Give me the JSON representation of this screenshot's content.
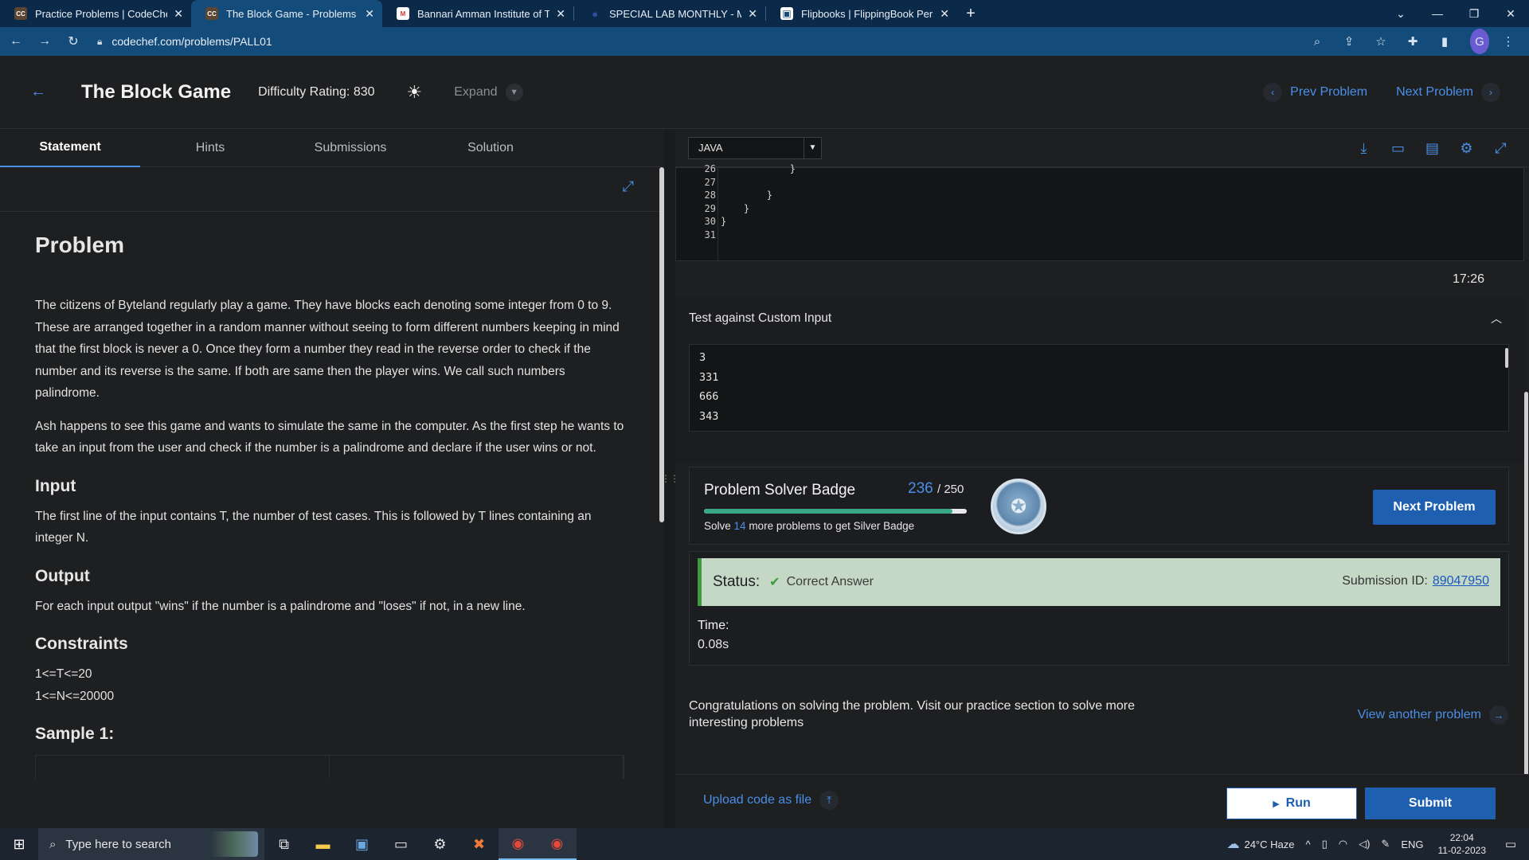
{
  "browser": {
    "tabs": [
      {
        "title": "Practice Problems | CodeChef",
        "favicon": "CC",
        "active": false
      },
      {
        "title": "The Block Game - Problems | Coc",
        "favicon": "CC",
        "active": true
      },
      {
        "title": "Bannari Amman Institute of Tech",
        "favicon": "M",
        "active": false
      },
      {
        "title": "SPECIAL LAB MONTHLY - MAGA",
        "favicon": "●",
        "active": false
      },
      {
        "title": "Flipbooks | FlippingBook Persona",
        "favicon": "▣",
        "active": false
      }
    ],
    "url": "codechef.com/problems/PALL01",
    "profile_initial": "G"
  },
  "header": {
    "title": "The Block Game",
    "difficulty": "Difficulty Rating: 830",
    "expand_label": "Expand",
    "prev_label": "Prev Problem",
    "next_label": "Next Problem"
  },
  "left": {
    "tabs": [
      "Statement",
      "Hints",
      "Submissions",
      "Solution"
    ],
    "problem_heading": "Problem",
    "para1": "The citizens of Byteland regularly play a game. They have blocks each denoting some integer from 0 to 9. These are arranged together in a random manner without seeing to form different numbers keeping in mind that the first block is never a 0. Once they form a number they read in the reverse order to check if the number and its reverse is the same. If both are same then the player wins. We call such numbers palindrome.",
    "para2": "Ash happens to see this game and wants to simulate the same in the computer. As the first step he wants to take an input from the user and check if the number is a palindrome and declare if the user wins or not.",
    "input_heading": "Input",
    "input_text": "The first line of the input contains T, the number of test cases. This is followed by T lines containing an integer N.",
    "output_heading": "Output",
    "output_text": "For each input output \"wins\" if the number is a palindrome and \"loses\" if not, in a new line.",
    "constraints_heading": "Constraints",
    "constraint1": "1<=T<=20",
    "constraint2": "1<=N<=20000",
    "sample_heading": "Sample 1:"
  },
  "editor": {
    "language": "JAVA",
    "line_numbers": [
      "26",
      "27",
      "28",
      "29",
      "30",
      "31"
    ],
    "code_lines": [
      "            }",
      "",
      "        }",
      "    }",
      "}",
      ""
    ],
    "timer": "17:26"
  },
  "custom_input": {
    "heading": "Test against Custom Input",
    "lines": [
      "3",
      "331",
      "666",
      "343"
    ]
  },
  "badge": {
    "title": "Problem Solver Badge",
    "score": "236",
    "total": "/ 250",
    "progress": 0.944,
    "note_prefix": "Solve ",
    "note_count": "14",
    "note_suffix": " more problems to get Silver Badge",
    "next_button": "Next Problem"
  },
  "result": {
    "status_label": "Status:",
    "status_value": "Correct Answer",
    "submission_label": "Submission ID:",
    "submission_id": "89047950",
    "time_label": "Time:",
    "time_value": "0.08s"
  },
  "congrats": {
    "text": "Congratulations on solving the problem. Visit our practice section to solve more interesting problems",
    "link": "View another problem"
  },
  "bottom": {
    "upload_label": "Upload code as file",
    "run_label": "Run",
    "submit_label": "Submit"
  },
  "taskbar": {
    "search_placeholder": "Type here to search",
    "weather": "24°C  Haze",
    "lang": "ENG",
    "time": "22:04",
    "date": "11-02-2023"
  },
  "colors": {
    "accent": "#4a8fe7",
    "primary_button": "#1f5fb0",
    "success_bg": "#c5d8c5",
    "success_border": "#3f9a3f"
  }
}
